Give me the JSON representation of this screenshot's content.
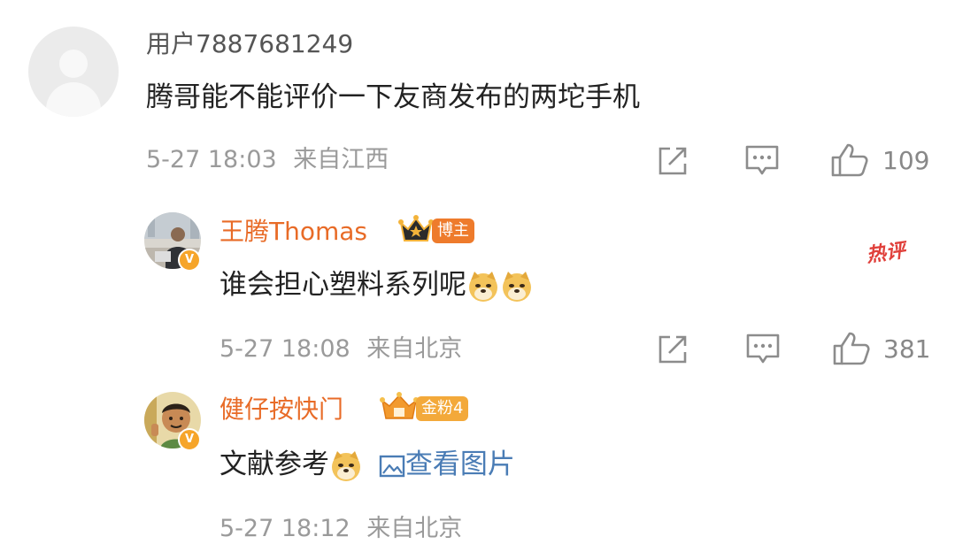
{
  "comment": {
    "username": "用户7887681249",
    "text": "腾哥能不能评价一下友商发布的两坨手机",
    "timestamp": "5-27 18:03",
    "location": "来自江西",
    "likes": "109"
  },
  "reply1": {
    "username": "王腾Thomas",
    "badge": "博主",
    "text": "谁会担心塑料系列呢",
    "hot_label": "热评",
    "timestamp": "5-27 18:08",
    "location": "来自北京",
    "likes": "381"
  },
  "reply2": {
    "username": "健仔按快门",
    "badge": "金粉4",
    "text": "文献参考",
    "view_image": "查看图片",
    "timestamp": "5-27 18:12",
    "location": "来自北京"
  },
  "icons": {
    "share": "share-icon",
    "comment": "comment-icon",
    "like": "thumbs-up-icon",
    "emoji": "doge-emoji-icon",
    "image": "image-icon"
  },
  "colors": {
    "blogger_name": "#e86b27",
    "link": "#4a7cb5",
    "hot": "#e0403b",
    "meta": "#9a9a9a"
  }
}
